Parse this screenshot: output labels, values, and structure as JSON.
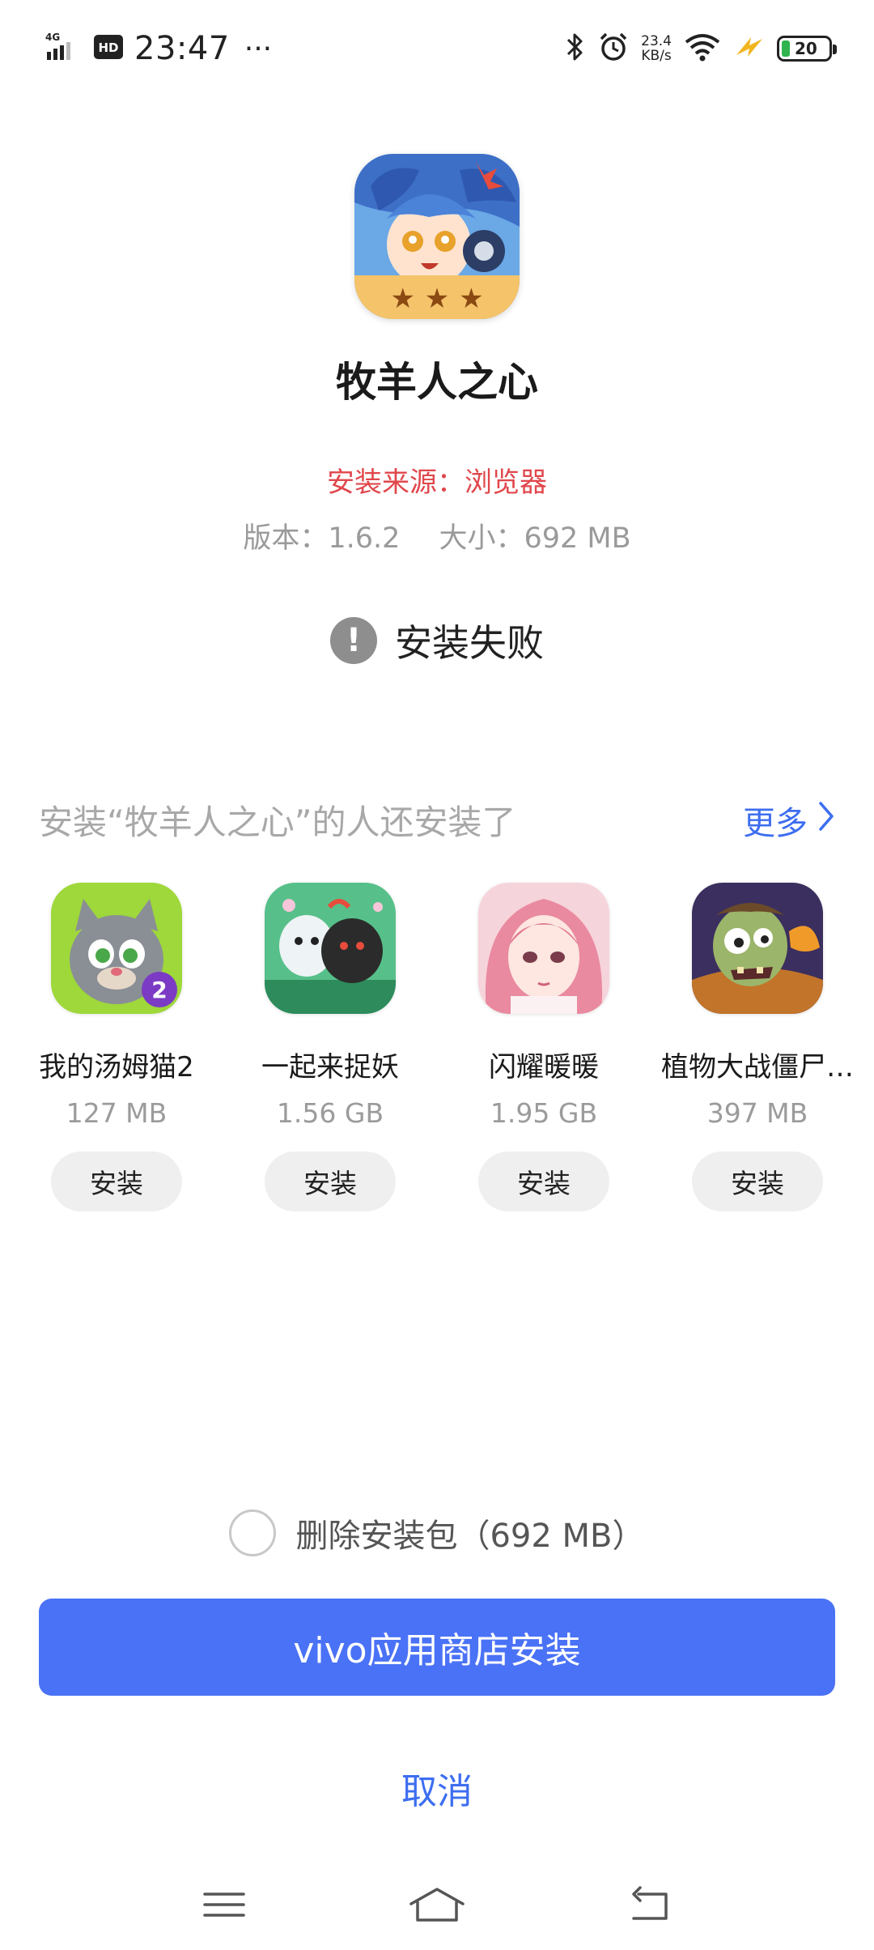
{
  "status_bar": {
    "network": "4G",
    "hd": "HD",
    "time": "23:47",
    "dots": "···",
    "speed_value": "23.4",
    "speed_unit": "KB/s",
    "battery": "20"
  },
  "app": {
    "icon": "app-icon-game",
    "name": "牧羊人之心",
    "install_source": "安装来源：浏览器",
    "version": "版本：1.6.2",
    "size": "大小：692 MB",
    "status": "安装失败"
  },
  "recommend": {
    "title": "安装“牧羊人之心”的人还安装了",
    "more_label": "更多",
    "items": [
      {
        "name": "我的汤姆猫2",
        "size": "127 MB",
        "button": "安装"
      },
      {
        "name": "一起来捉妖",
        "size": "1.56 GB",
        "button": "安装"
      },
      {
        "name": "闪耀暖暖",
        "size": "1.95 GB",
        "button": "安装"
      },
      {
        "name": "植物大战僵尸…",
        "size": "397 MB",
        "button": "安装"
      }
    ]
  },
  "actions": {
    "delete_package_label": "删除安装包（692 MB）",
    "delete_checked": false,
    "primary_label": "vivo应用商店安装",
    "cancel_label": "取消"
  },
  "colors": {
    "accent": "#4a72f6",
    "link": "#3d6ef0",
    "source": "#e0474c"
  }
}
